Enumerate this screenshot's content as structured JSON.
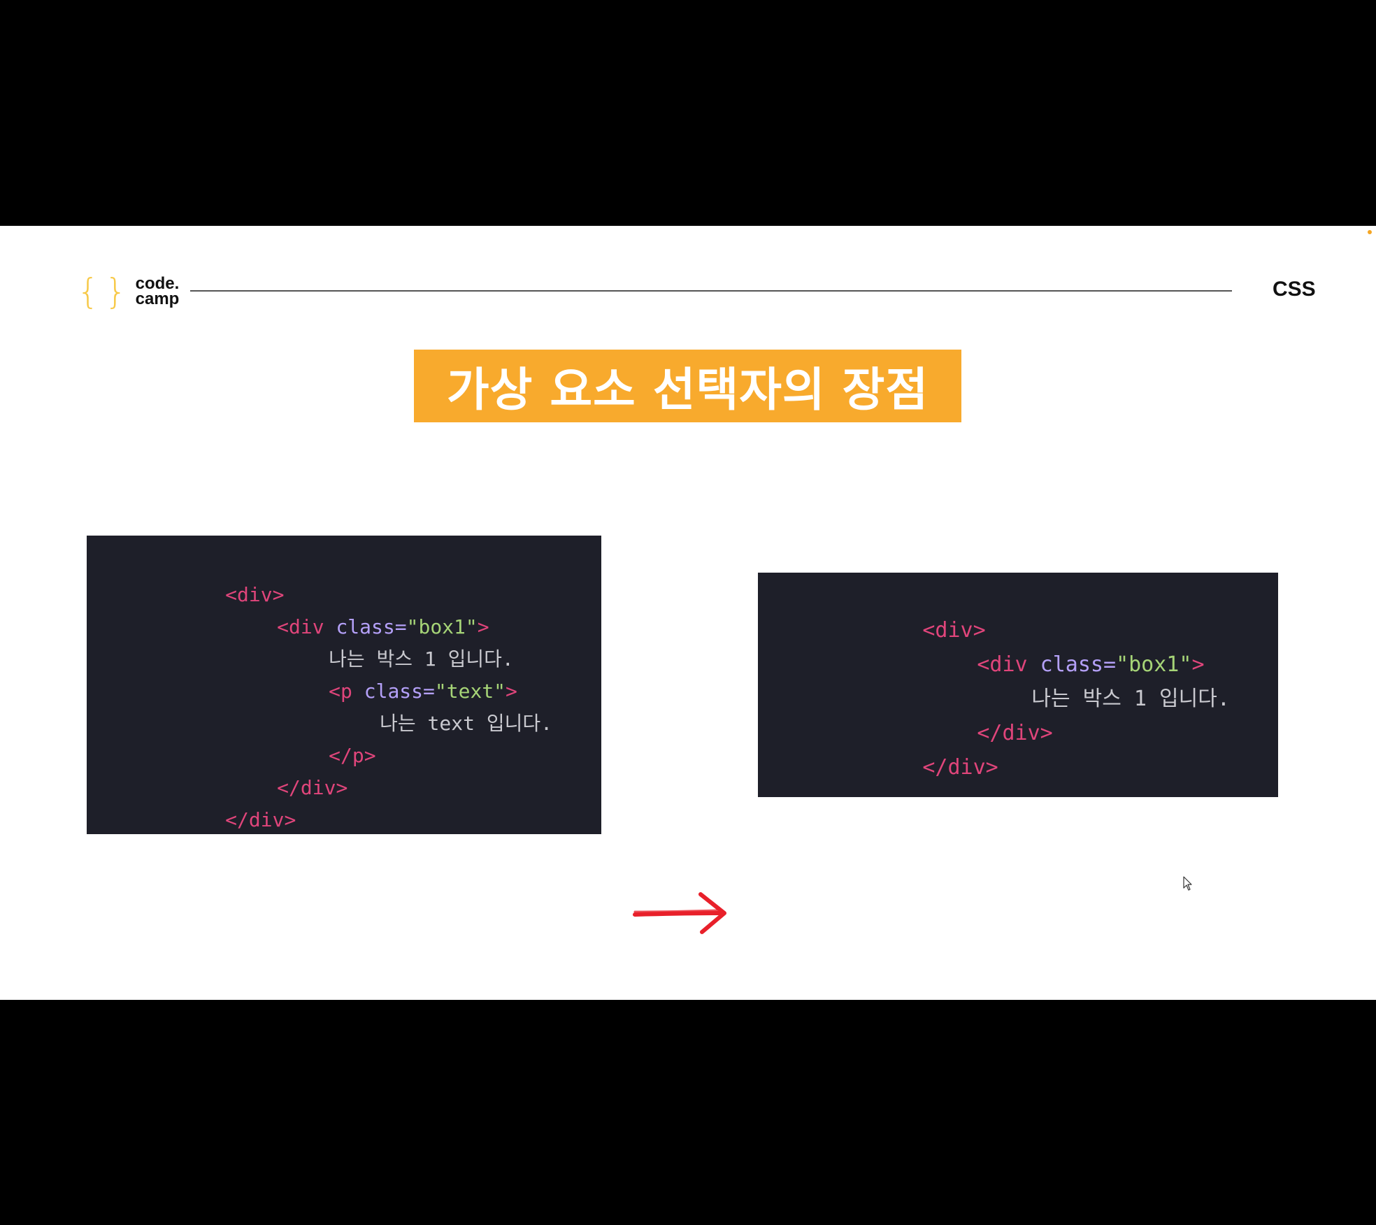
{
  "header": {
    "logo_line1": "code.",
    "logo_line2": "camp",
    "section_tag": "CSS"
  },
  "title": "가상 요소 선택자의 장점",
  "colors": {
    "accent": "#f8aa2d",
    "logo_braces": "#f7c948",
    "code_bg": "#1e1f29",
    "tag": "#e0457b",
    "attr": "#b4a0f8",
    "string": "#a6d477",
    "text": "#c9c9cf",
    "arrow": "#e8202a"
  },
  "icons": {
    "arrow": "red-arrow-right-icon",
    "cursor": "mouse-pointer-icon"
  },
  "before_code": {
    "lines": [
      {
        "open": "<div>"
      },
      {
        "tag": "<div",
        "attr": " class=",
        "str": "\"box1\"",
        "close": ">"
      },
      {
        "text": "나는 박스 1 입니다."
      },
      {
        "tag": "<p",
        "attr": " class=",
        "str": "\"text\"",
        "close": ">"
      },
      {
        "text": "나는 text 입니다."
      },
      {
        "open": "</p>"
      },
      {
        "open": "</div>"
      },
      {
        "open": "</div>"
      }
    ]
  },
  "after_code": {
    "lines": [
      {
        "open": "<div>"
      },
      {
        "tag": "<div",
        "attr": " class=",
        "str": "\"box1\"",
        "close": ">"
      },
      {
        "text": "나는 박스 1 입니다."
      },
      {
        "open": "</div>"
      },
      {
        "open": "</div>"
      }
    ]
  }
}
